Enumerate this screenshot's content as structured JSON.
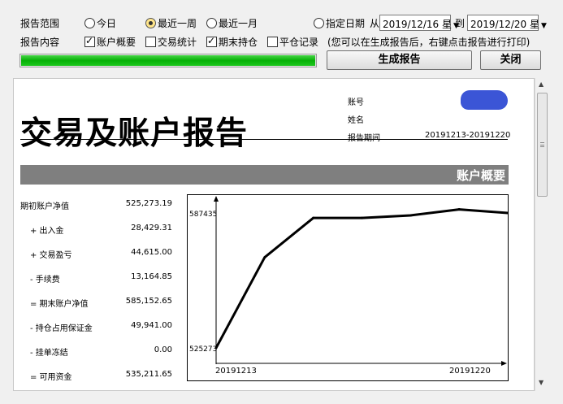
{
  "toolbar": {
    "range_label": "报告范围",
    "range_options": [
      "今日",
      "最近一周",
      "最近一月"
    ],
    "range_selected": "最近一周",
    "specify_date_label": "指定日期",
    "from_label": "从",
    "from_date": "2019/12/16 星",
    "to_label": "到",
    "to_date": "2019/12/20 星",
    "content_label": "报告内容",
    "content_options": [
      {
        "label": "账户概要",
        "checked": true
      },
      {
        "label": "交易统计",
        "checked": false
      },
      {
        "label": "期末持仓",
        "checked": true
      },
      {
        "label": "平仓记录",
        "checked": false
      }
    ],
    "hint": "(您可以在生成报告后，右键点击报告进行打印)",
    "progress": 1.0,
    "generate_label": "生成报告",
    "close_label": "关闭"
  },
  "report": {
    "title": "交易及账户报告",
    "account_label": "账号",
    "name_label": "姓名",
    "period_label": "报告期间",
    "period_value": "20191213-20191220",
    "section_title": "账户概要",
    "stats": [
      {
        "label": "期初账户净值",
        "value": "525,273.19"
      },
      {
        "label": "+ 出入金",
        "value": "28,429.31"
      },
      {
        "label": "+ 交易盈亏",
        "value": "44,615.00"
      },
      {
        "label": "- 手续费",
        "value": "13,164.85"
      },
      {
        "label": "= 期末账户净值",
        "value": "585,152.65"
      },
      {
        "label": "- 持仓占用保证金",
        "value": "49,941.00"
      },
      {
        "label": "- 挂单冻结",
        "value": "0.00"
      },
      {
        "label": "= 可用资金",
        "value": "535,211.65"
      }
    ]
  },
  "chart_data": {
    "type": "line",
    "y_tick_labels": [
      "587435",
      "525273"
    ],
    "x_tick_labels": [
      "20191213",
      "20191220"
    ],
    "ylim": [
      525273,
      587435
    ],
    "x": [
      0,
      1,
      2,
      3,
      4,
      5,
      6
    ],
    "values": [
      525273,
      567000,
      585152,
      585152,
      586300,
      589100,
      587435
    ],
    "title": "",
    "xlabel": "",
    "ylabel": ""
  }
}
